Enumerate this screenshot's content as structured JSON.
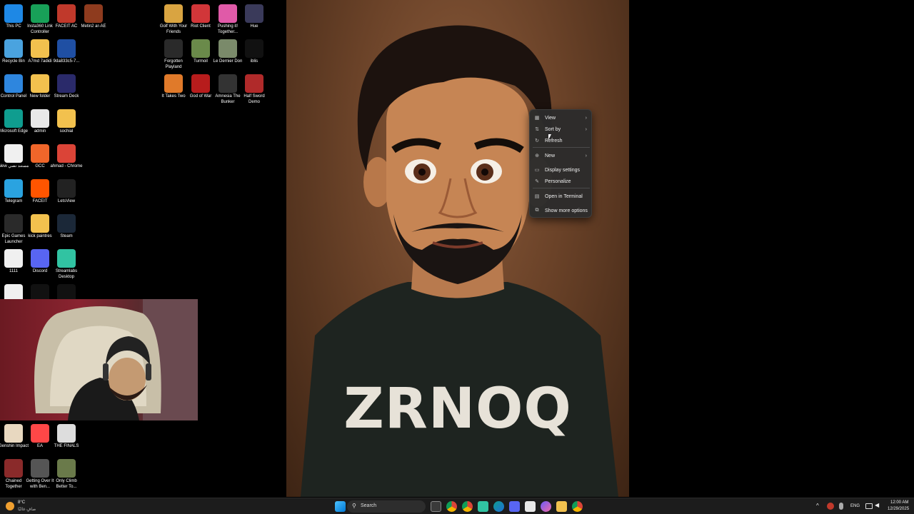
{
  "desktop_icons": [
    {
      "label": "This PC",
      "icon": "monitor-icon",
      "color": "#1e88e5"
    },
    {
      "label": "Insta360 Link Controller",
      "icon": "camera-ring-icon",
      "color": "#18a058"
    },
    {
      "label": "FACEIT AC",
      "icon": "faceit-shield-icon",
      "color": "#c0392b"
    },
    {
      "label": "Metin2 ar-AE",
      "icon": "metin2-icon",
      "color": "#8e3b1e"
    },
    {
      "label": "Recycle Bin",
      "icon": "recycle-bin-icon",
      "color": "#4aa3df"
    },
    {
      "label": "A7md 7adidi",
      "icon": "folder-icon",
      "color": "#f2c14e"
    },
    {
      "label": "9da833c5-7...",
      "icon": "paypal-file-icon",
      "color": "#1f4fa3"
    },
    {
      "label": "Control Panel",
      "icon": "control-panel-icon",
      "color": "#2e86de"
    },
    {
      "label": "New folder",
      "icon": "folder-icon",
      "color": "#f2c14e"
    },
    {
      "label": "Stream Deck",
      "icon": "stream-deck-icon",
      "color": "#2a2a6a"
    },
    {
      "label": "Microsoft Edge",
      "icon": "edge-icon",
      "color": "#0f9d8f"
    },
    {
      "label": "admin",
      "icon": "document-icon",
      "color": "#e8e8e8"
    },
    {
      "label": "sochial",
      "icon": "folder-icon",
      "color": "#f2c14e"
    },
    {
      "label": "New مستند نصي",
      "icon": "text-file-icon",
      "color": "#f0f0f0"
    },
    {
      "label": "GCC",
      "icon": "gcc-icon",
      "color": "#f0662a"
    },
    {
      "label": "ahmad - Chrome",
      "icon": "chrome-icon",
      "color": "#db4437"
    },
    {
      "label": "Telegram",
      "icon": "telegram-icon",
      "color": "#2aa3e0"
    },
    {
      "label": "FACEIT",
      "icon": "faceit-icon",
      "color": "#ff5500"
    },
    {
      "label": "LetsView",
      "icon": "letsview-icon",
      "color": "#222222"
    },
    {
      "label": "Epic Games Launcher",
      "icon": "epic-games-icon",
      "color": "#2a2a2a"
    },
    {
      "label": "kick paintres",
      "icon": "folder-icon",
      "color": "#f2c14e"
    },
    {
      "label": "Steam",
      "icon": "steam-icon",
      "color": "#1b2838"
    },
    {
      "label": "1111",
      "icon": "text-file-icon",
      "color": "#f0f0f0"
    },
    {
      "label": "Discord",
      "icon": "discord-icon",
      "color": "#5865f2"
    },
    {
      "label": "Streamlabs Desktop",
      "icon": "streamlabs-icon",
      "color": "#31c3a2"
    },
    {
      "label": "",
      "icon": "text-file-icon",
      "color": "#f0f0f0"
    },
    {
      "label": "",
      "icon": "logitech-g-icon",
      "color": "#111111"
    },
    {
      "label": "",
      "icon": "ubisoft-icon",
      "color": "#111111"
    },
    {
      "label": "Golf With Your Friends",
      "icon": "golf-game-icon",
      "color": "#d9a441"
    },
    {
      "label": "Riot Client",
      "icon": "riot-client-icon",
      "color": "#d13639"
    },
    {
      "label": "Pushing it! Together...",
      "icon": "pushing-it-icon",
      "color": "#e05aa8"
    },
    {
      "label": "Hue",
      "icon": "hue-game-icon",
      "color": "#3a3a5a"
    },
    {
      "label": "Forgotten Playland",
      "icon": "epic-games-icon",
      "color": "#2a2a2a"
    },
    {
      "label": "Turmoil",
      "icon": "turmoil-icon",
      "color": "#6a8a4a"
    },
    {
      "label": "Le Dernier Don",
      "icon": "le-dernier-don-icon",
      "color": "#7a8a6a"
    },
    {
      "label": "iblis",
      "icon": "iblis-icon",
      "color": "#111111"
    },
    {
      "label": "It Takes Two",
      "icon": "it-takes-two-icon",
      "color": "#e07a2a"
    },
    {
      "label": "God of War",
      "icon": "god-of-war-icon",
      "color": "#b71c1c"
    },
    {
      "label": "Amnesia The Bunker",
      "icon": "amnesia-icon",
      "color": "#333333"
    },
    {
      "label": "Half Sword Demo",
      "icon": "half-sword-icon",
      "color": "#b02a2a"
    },
    {
      "label": "Genshin Impact",
      "icon": "genshin-icon",
      "color": "#e8d8c0"
    },
    {
      "label": "EA",
      "icon": "ea-icon",
      "color": "#ff4747"
    },
    {
      "label": "THE FINALS",
      "icon": "the-finals-icon",
      "color": "#dddddd"
    },
    {
      "label": "Chained Together",
      "icon": "chained-together-icon",
      "color": "#8a2a2a"
    },
    {
      "label": "Getting Over It with Ben...",
      "icon": "getting-over-it-icon",
      "color": "#555555"
    },
    {
      "label": "Only Climb Better To...",
      "icon": "only-climb-icon",
      "color": "#6a7a4a"
    }
  ],
  "wallpaper": {
    "shirt_text": "ZRNOQ"
  },
  "context_menu": {
    "items": [
      {
        "label": "View",
        "icon": "grid-icon",
        "submenu": true
      },
      {
        "label": "Sort by",
        "icon": "sort-icon",
        "submenu": true
      },
      {
        "label": "Refresh",
        "icon": "refresh-icon",
        "submenu": false
      },
      {
        "label": "New",
        "icon": "new-plus-icon",
        "submenu": true
      },
      {
        "label": "Display settings",
        "icon": "display-icon",
        "submenu": false
      },
      {
        "label": "Personalize",
        "icon": "brush-icon",
        "submenu": false
      },
      {
        "label": "Open in Terminal",
        "icon": "terminal-icon",
        "submenu": false
      },
      {
        "label": "Show more options",
        "icon": "more-options-icon",
        "submenu": false
      }
    ]
  },
  "taskbar": {
    "weather_temp": "8°C",
    "weather_desc": "صافٍ غالبًا",
    "search_placeholder": "Search",
    "language": "ENG",
    "time": "12:00 AM",
    "date": "12/29/2025",
    "accent": "#1c1c1c"
  }
}
